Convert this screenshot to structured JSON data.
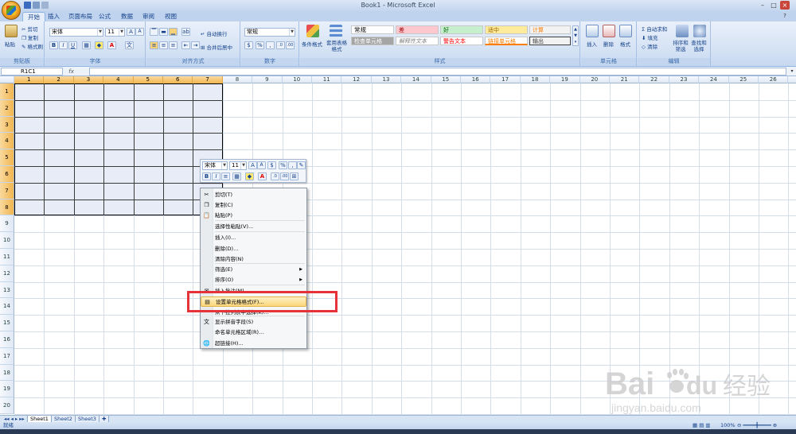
{
  "window": {
    "title": "Book1 - Microsoft Excel"
  },
  "tabs": [
    "开始",
    "插入",
    "页面布局",
    "公式",
    "数据",
    "审阅",
    "视图"
  ],
  "ribbon": {
    "clipboard": {
      "label": "剪贴板",
      "paste": "粘贴",
      "cut": "剪切",
      "copy": "复制",
      "format_painter": "格式刷"
    },
    "font": {
      "label": "字体",
      "name": "宋体",
      "size": "11"
    },
    "alignment": {
      "label": "对齐方式",
      "wrap": "自动换行",
      "merge": "合并后居中"
    },
    "number": {
      "label": "数字",
      "format": "常规"
    },
    "styles": {
      "label": "样式",
      "cond_format": "条件格式",
      "table_format": "套用表格格式",
      "cells": [
        {
          "text": "常规",
          "bg": "#ffffff",
          "color": "#000000"
        },
        {
          "text": "差",
          "bg": "#ffc7ce",
          "color": "#9c0006"
        },
        {
          "text": "好",
          "bg": "#c6efce",
          "color": "#006100"
        },
        {
          "text": "适中",
          "bg": "#ffeb9c",
          "color": "#9c6500"
        },
        {
          "text": "计算",
          "bg": "#f2f2f2",
          "color": "#fa7d00"
        },
        {
          "text": "检查单元格",
          "bg": "#a5a5a5",
          "color": "#ffffff"
        },
        {
          "text": "解释性文本",
          "bg": "#ffffff",
          "color": "#7f7f7f"
        },
        {
          "text": "警告文本",
          "bg": "#ffffff",
          "color": "#ff0000"
        },
        {
          "text": "链接单元格",
          "bg": "#ffffff",
          "color": "#fa7d00"
        },
        {
          "text": "输出",
          "bg": "#f2f2f2",
          "color": "#3f3f3f"
        }
      ]
    },
    "cells": {
      "label": "单元格",
      "insert": "插入",
      "delete": "删除",
      "format": "格式"
    },
    "editing": {
      "label": "编辑",
      "autosum": "自动求和",
      "fill": "填充",
      "clear": "清除",
      "sort": "排序和筛选",
      "find": "查找和选择"
    }
  },
  "formula_bar": {
    "namebox": "R1C1",
    "fx": "fx"
  },
  "columns": [
    "1",
    "2",
    "3",
    "4",
    "5",
    "6",
    "7",
    "8",
    "9",
    "10",
    "11",
    "12",
    "13",
    "14",
    "15",
    "16",
    "17",
    "18",
    "19",
    "20",
    "21",
    "22",
    "23",
    "24",
    "25",
    "26"
  ],
  "rows": [
    "1",
    "2",
    "3",
    "4",
    "5",
    "6",
    "7",
    "8",
    "9",
    "10",
    "11",
    "12",
    "13",
    "14",
    "15",
    "16",
    "17",
    "18",
    "19",
    "20"
  ],
  "mini_toolbar": {
    "font": "宋体",
    "size": "11"
  },
  "context_menu": [
    {
      "label": "剪切(T)",
      "icon": "scissors-icon"
    },
    {
      "label": "复制(C)",
      "icon": "copy-icon"
    },
    {
      "label": "粘贴(P)",
      "icon": "paste-icon"
    },
    {
      "label": "选择性粘贴(V)...",
      "icon": ""
    },
    {
      "label": "插入(I)...",
      "icon": ""
    },
    {
      "label": "删除(D)...",
      "icon": ""
    },
    {
      "label": "清除内容(N)",
      "icon": ""
    },
    {
      "label": "筛选(E)",
      "icon": "",
      "submenu": true
    },
    {
      "label": "排序(O)",
      "icon": "",
      "submenu": true
    },
    {
      "label": "插入批注(M)",
      "icon": "comment-icon"
    },
    {
      "label": "设置单元格格式(F)...",
      "icon": "format-cells-icon",
      "highlighted": true
    },
    {
      "label": "从下拉列表中选择(K)...",
      "icon": ""
    },
    {
      "label": "显示拼音字段(S)",
      "icon": "phonetic-icon"
    },
    {
      "label": "命名单元格区域(R)...",
      "icon": ""
    },
    {
      "label": "超链接(H)...",
      "icon": "hyperlink-icon"
    }
  ],
  "sheets": [
    "Sheet1",
    "Sheet2",
    "Sheet3"
  ],
  "status": {
    "ready": "就绪",
    "zoom": "100%"
  },
  "watermark": {
    "brand": "Bai",
    "brand2": "du",
    "cn": "经验",
    "url": "jingyan.baidu.com"
  },
  "colors": {
    "accent": "#15428b",
    "highlight": "#e6333a",
    "selected_header": "#f1b54e"
  }
}
